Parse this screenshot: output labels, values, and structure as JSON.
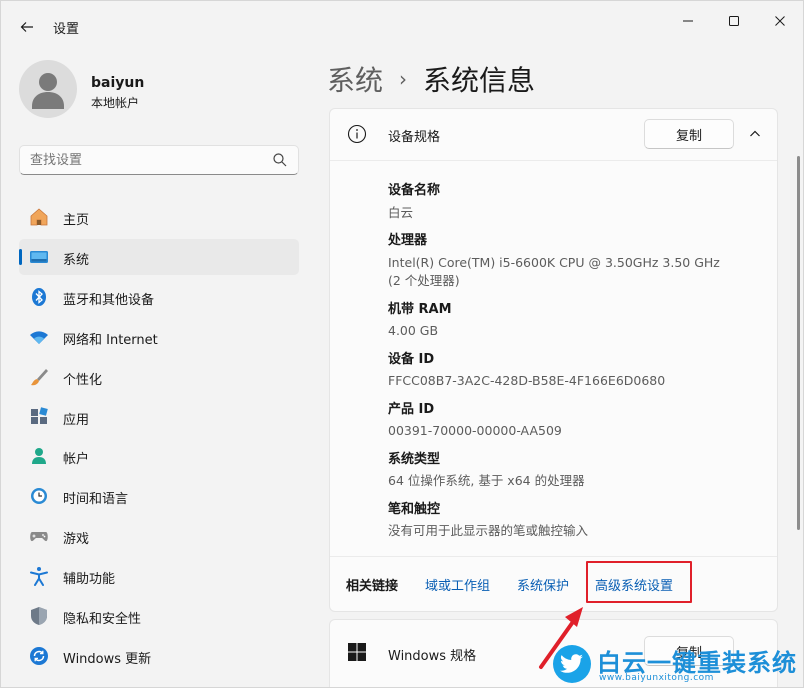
{
  "window": {
    "title": "设置"
  },
  "user": {
    "name": "baiyun",
    "account_type": "本地帐户"
  },
  "search": {
    "placeholder": "查找设置"
  },
  "sidebar": {
    "items": [
      {
        "label": "主页",
        "icon": "home-icon"
      },
      {
        "label": "系统",
        "icon": "system-display-icon",
        "active": true
      },
      {
        "label": "蓝牙和其他设备",
        "icon": "bluetooth-icon"
      },
      {
        "label": "网络和 Internet",
        "icon": "wifi-icon"
      },
      {
        "label": "个性化",
        "icon": "brush-icon"
      },
      {
        "label": "应用",
        "icon": "apps-icon"
      },
      {
        "label": "帐户",
        "icon": "account-icon"
      },
      {
        "label": "时间和语言",
        "icon": "globe-clock-icon"
      },
      {
        "label": "游戏",
        "icon": "gamepad-icon"
      },
      {
        "label": "辅助功能",
        "icon": "accessibility-icon"
      },
      {
        "label": "隐私和安全性",
        "icon": "shield-icon"
      },
      {
        "label": "Windows 更新",
        "icon": "update-icon"
      }
    ]
  },
  "breadcrumb": {
    "parent": "系统",
    "separator": "›",
    "current": "系统信息"
  },
  "device_spec": {
    "title": "设备规格",
    "copy_label": "复制",
    "rows": [
      {
        "label": "设备名称",
        "value": "白云"
      },
      {
        "label": "处理器",
        "value": "Intel(R) Core(TM) i5-6600K CPU @ 3.50GHz   3.50 GHz",
        "value2": "(2 个处理器)"
      },
      {
        "label": "机带 RAM",
        "value": "4.00 GB"
      },
      {
        "label": "设备 ID",
        "value": "FFCC08B7-3A2C-428D-B58E-4F166E6D0680"
      },
      {
        "label": "产品 ID",
        "value": "00391-70000-00000-AA509"
      },
      {
        "label": "系统类型",
        "value": "64 位操作系统, 基于 x64 的处理器"
      },
      {
        "label": "笔和触控",
        "value": "没有可用于此显示器的笔或触控输入"
      }
    ]
  },
  "related_links": {
    "label": "相关链接",
    "links": [
      "域或工作组",
      "系统保护",
      "高级系统设置"
    ]
  },
  "windows_spec": {
    "title": "Windows 规格",
    "copy_label": "复制"
  },
  "watermark": {
    "text": "白云一键重装系统",
    "url": "www.baiyunxitong.com"
  },
  "colors": {
    "accent": "#0067c0",
    "link": "#0a5fb4",
    "highlight": "#e0202a",
    "watermark": "#1d8fd8"
  }
}
